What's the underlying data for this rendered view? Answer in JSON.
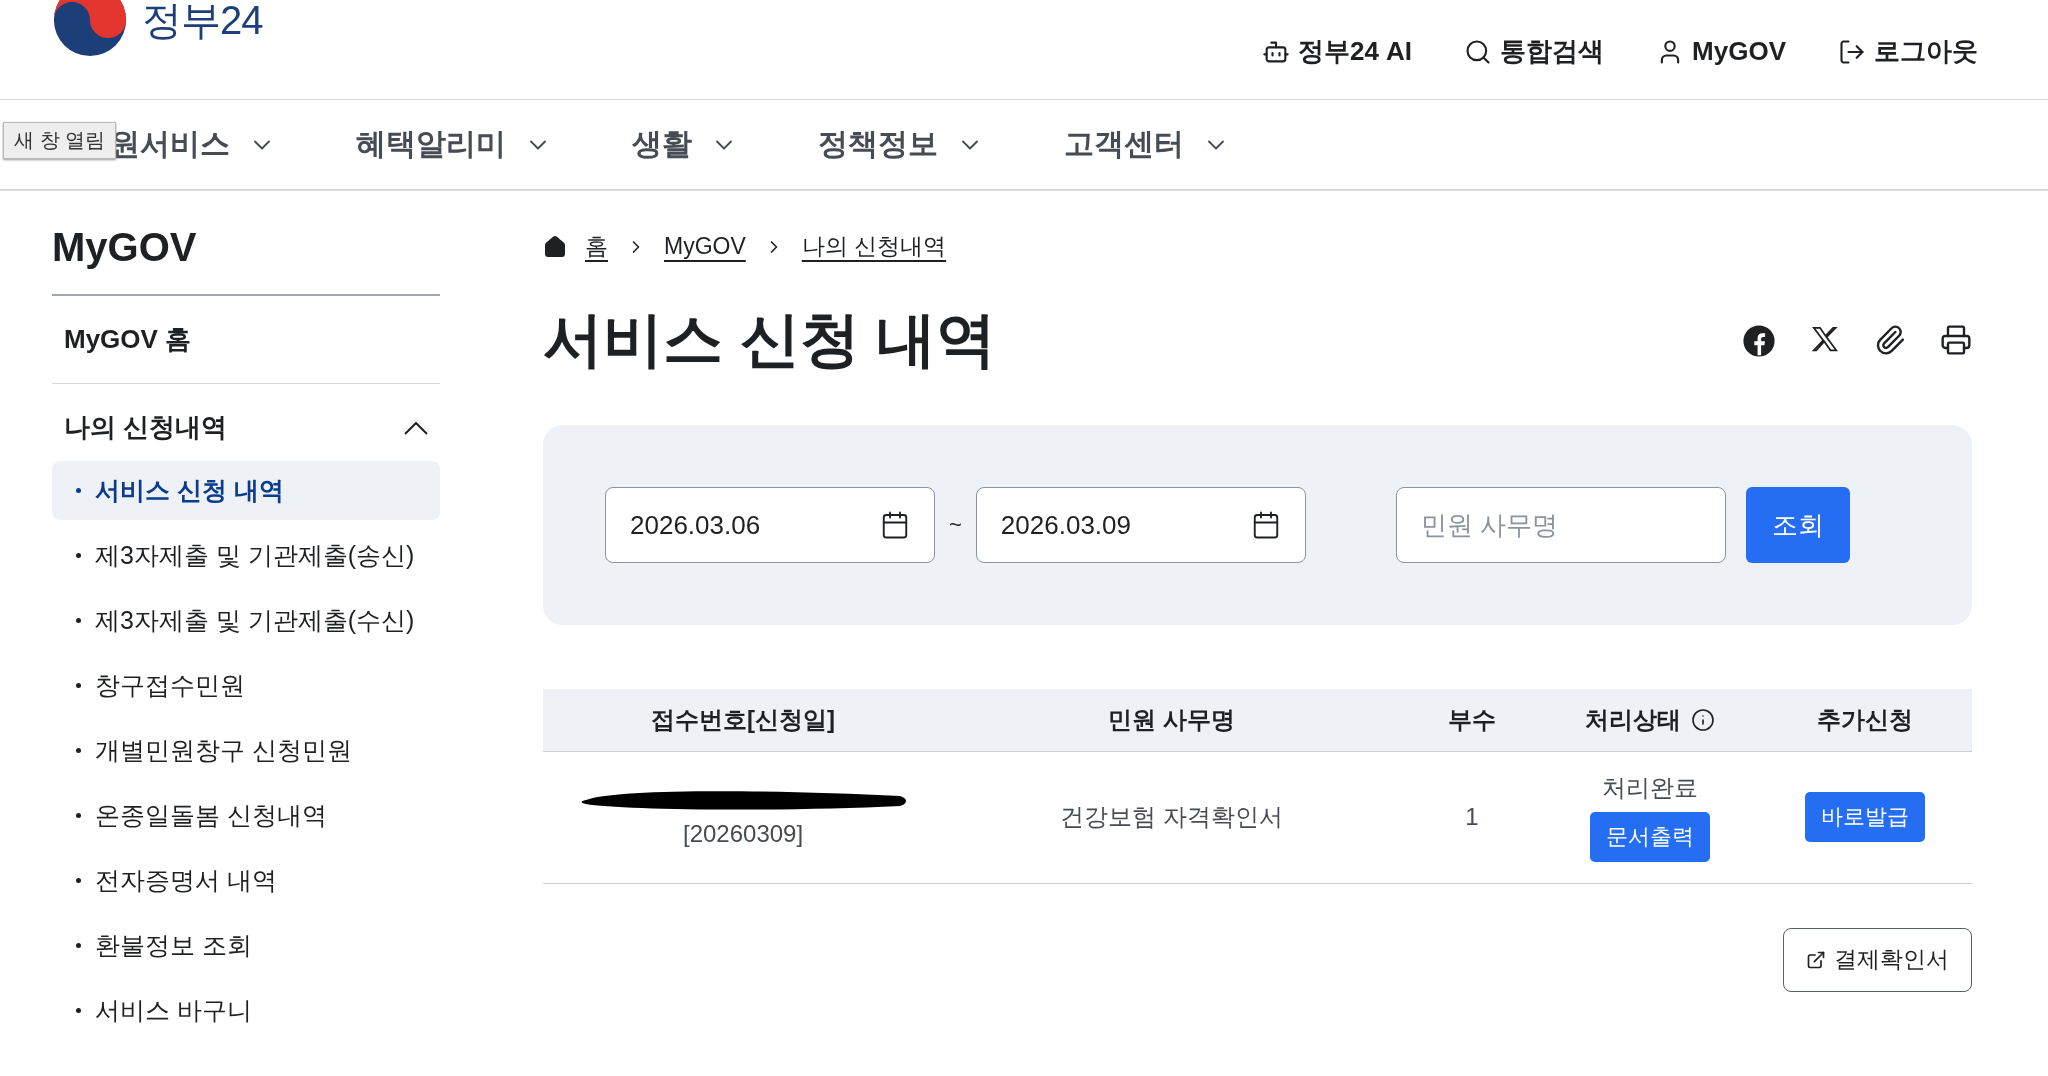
{
  "header": {
    "logo_text": "정부24",
    "utility": [
      {
        "kind": "ai",
        "label": "정부24 AI"
      },
      {
        "kind": "search",
        "label": "통합검색"
      },
      {
        "kind": "user",
        "label": "MyGOV"
      },
      {
        "kind": "logout",
        "label": "로그아웃"
      }
    ]
  },
  "nav": {
    "tooltip": "새 창 열림",
    "items": [
      "원서비스",
      "혜택알리미",
      "생활",
      "정책정보",
      "고객센터"
    ]
  },
  "sidebar": {
    "title": "MyGOV",
    "items": [
      {
        "label": "MyGOV 홈",
        "kind": "link"
      },
      {
        "label": "나의 신청내역",
        "kind": "group",
        "expanded": true,
        "children": [
          {
            "label": "서비스 신청 내역",
            "selected": true
          },
          {
            "label": "제3자제출 및 기관제출(송신)",
            "selected": false
          },
          {
            "label": "제3자제출 및 기관제출(수신)",
            "selected": false
          },
          {
            "label": "창구접수민원",
            "selected": false
          },
          {
            "label": "개별민원창구 신청민원",
            "selected": false
          },
          {
            "label": "온종일돌봄 신청내역",
            "selected": false
          },
          {
            "label": "전자증명서 내역",
            "selected": false
          },
          {
            "label": "환불정보 조회",
            "selected": false
          },
          {
            "label": "서비스 바구니",
            "selected": false
          }
        ]
      }
    ]
  },
  "breadcrumb": [
    "홈",
    "MyGOV",
    "나의 신청내역"
  ],
  "title": "서비스 신청 내역",
  "filter": {
    "start_date": "2026.03.06",
    "separator": "~",
    "end_date": "2026.03.09",
    "search": {
      "placeholder": "민원 사무명"
    },
    "button": "조회"
  },
  "table": {
    "columns": [
      "접수번호[신청일]",
      "민원 사무명",
      "부수",
      "처리상태",
      "추가신청"
    ],
    "rows": [
      {
        "date": "[20260309]",
        "service": "건강보험 자격확인서",
        "copies": "1",
        "status": "처리완료",
        "status_button": "문서출력",
        "action": "바로발급"
      }
    ]
  },
  "receipt_button": "결제확인서"
}
